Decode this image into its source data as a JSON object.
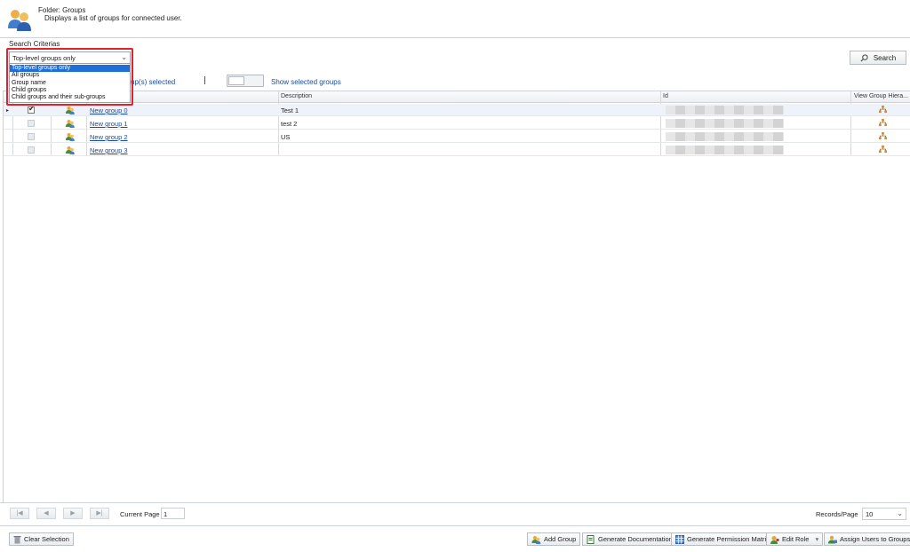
{
  "header": {
    "folder_title": "Folder: Groups",
    "folder_desc": "Displays a list of groups for connected user."
  },
  "search": {
    "criteria_label": "Search Criterias",
    "button_label": "Search",
    "scope_selected": "Top-level groups only",
    "scope_options": [
      "Top-level groups only",
      "All groups",
      "Group name",
      "Child groups",
      "Child groups and their sub-groups"
    ]
  },
  "selection": {
    "count_text": "up(s) selected",
    "show_selected_label": "Show selected groups"
  },
  "grid": {
    "columns": {
      "description": "Description",
      "id": "Id",
      "hierarchy": "View Group Hiera..."
    },
    "rows": [
      {
        "name": "New group 0",
        "description": "Test 1",
        "checked": true
      },
      {
        "name": "New group 1",
        "description": "test 2",
        "checked": false
      },
      {
        "name": "New group 2",
        "description": "US",
        "checked": false
      },
      {
        "name": "New group 3",
        "description": "",
        "checked": false
      }
    ]
  },
  "pager": {
    "current_page_label": "Current Page",
    "current_page": "1",
    "records_label": "Records/Page",
    "records_value": "10"
  },
  "footer": {
    "clear_selection": "Clear Selection",
    "add_group": "Add Group",
    "generate_documentation": "Generate Documentation",
    "generate_permission_matrix": "Generate Permission Matrix",
    "edit_role": "Edit Role",
    "assign_users": "Assign Users to Groups"
  },
  "colors": {
    "link": "#1a4a9c",
    "highlight": "#1e6fd9",
    "annotation_frame": "#e3212b"
  }
}
